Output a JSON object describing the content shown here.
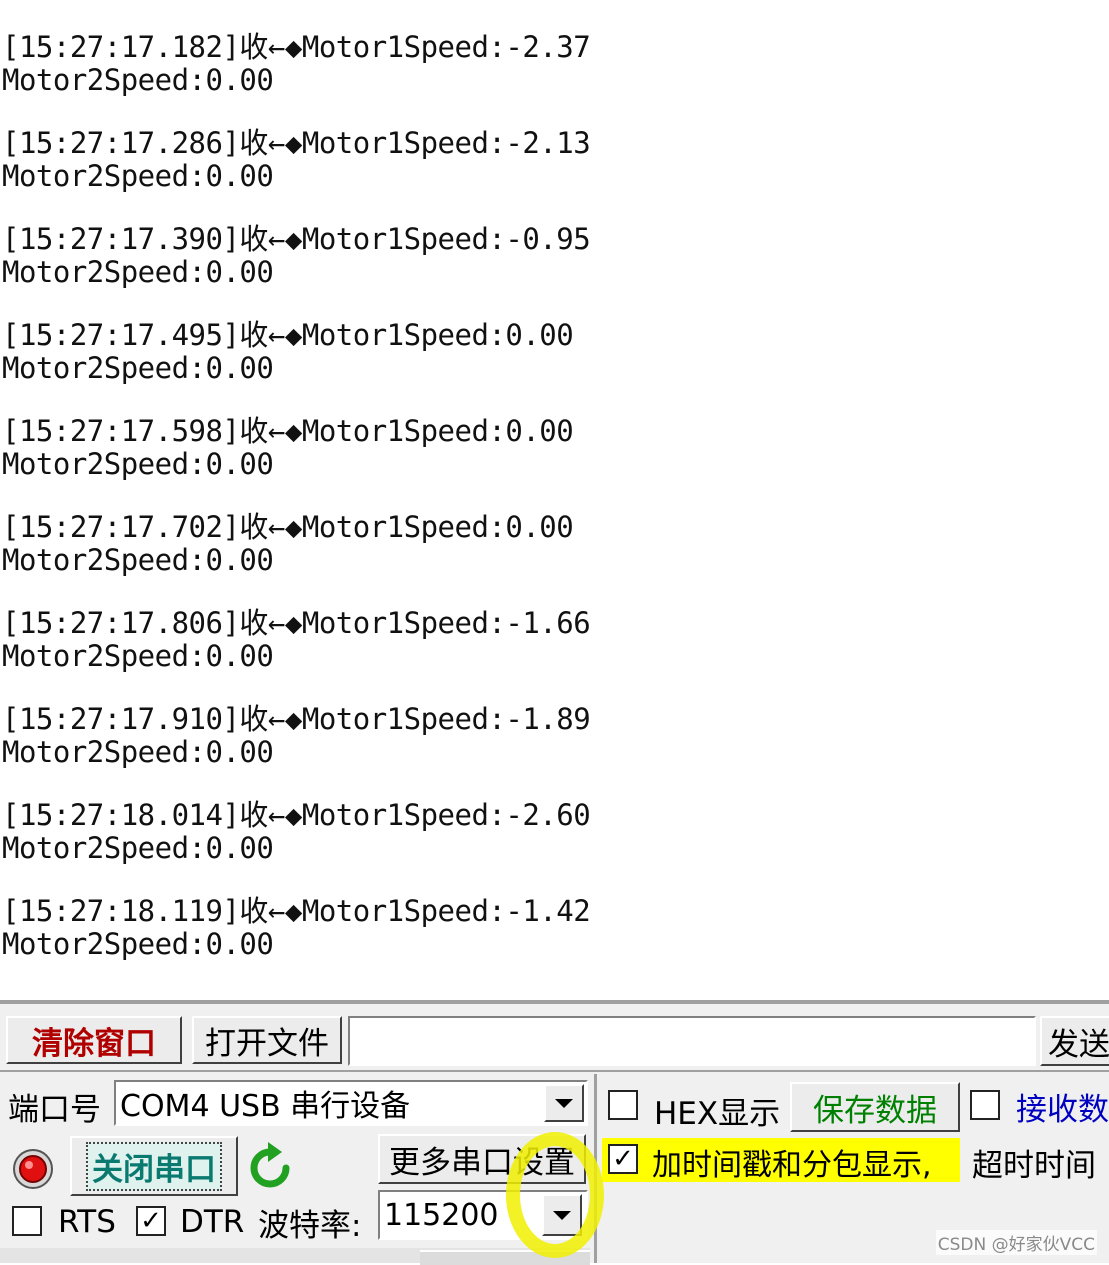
{
  "log": [
    {
      "prefix": "[15:27:17.182]收←◆",
      "m1": "Motor1Speed:-2.37",
      "m2": "Motor2Speed:0.00"
    },
    {
      "prefix": "[15:27:17.286]收←◆",
      "m1": "Motor1Speed:-2.13",
      "m2": "Motor2Speed:0.00"
    },
    {
      "prefix": "[15:27:17.390]收←◆",
      "m1": "Motor1Speed:-0.95",
      "m2": "Motor2Speed:0.00"
    },
    {
      "prefix": "[15:27:17.495]收←◆",
      "m1": "Motor1Speed:0.00",
      "m2": "Motor2Speed:0.00"
    },
    {
      "prefix": "[15:27:17.598]收←◆",
      "m1": "Motor1Speed:0.00",
      "m2": "Motor2Speed:0.00"
    },
    {
      "prefix": "[15:27:17.702]收←◆",
      "m1": "Motor1Speed:0.00",
      "m2": "Motor2Speed:0.00"
    },
    {
      "prefix": "[15:27:17.806]收←◆",
      "m1": "Motor1Speed:-1.66",
      "m2": "Motor2Speed:0.00"
    },
    {
      "prefix": "[15:27:17.910]收←◆",
      "m1": "Motor1Speed:-1.89",
      "m2": "Motor2Speed:0.00"
    },
    {
      "prefix": "[15:27:18.014]收←◆",
      "m1": "Motor1Speed:-2.60",
      "m2": "Motor2Speed:0.00"
    },
    {
      "prefix": "[15:27:18.119]收←◆",
      "m1": "Motor1Speed:-1.42",
      "m2": "Motor2Speed:0.00"
    }
  ],
  "toolbar": {
    "clear_label": "清除窗口",
    "open_file_label": "打开文件",
    "file_path": "",
    "send_label": "发送"
  },
  "port": {
    "label": "端口号",
    "value": "COM4 USB 串行设备",
    "close_label": "关闭串口",
    "more_settings_label": "更多串口设置",
    "rts_label": "RTS",
    "rts_checked": false,
    "dtr_label": "DTR",
    "dtr_checked": true,
    "baud_label": "波特率:",
    "baud_value": "115200"
  },
  "options": {
    "hex_label": "HEX显示",
    "hex_checked": false,
    "save_label": "保存数据",
    "recv_file_label": "接收数",
    "recv_file_checked": false,
    "timestamp_label": "加时间戳和分包显示,",
    "timestamp_checked": true,
    "timeout_label": "超时时间"
  },
  "watermark": "CSDN @好家伙VCC",
  "colors": {
    "highlight_yellow": "#ffff00",
    "annotation_circle": "#f2f200"
  }
}
